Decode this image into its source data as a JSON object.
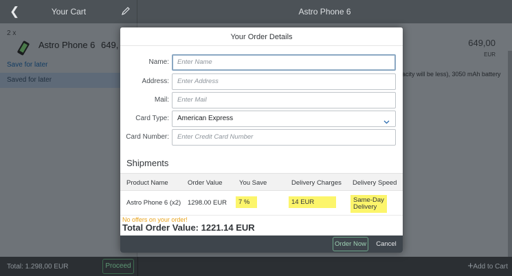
{
  "header": {
    "cart_title": "Your Cart",
    "detail_title": "Astro Phone 6"
  },
  "cart": {
    "quantity": "2 x",
    "item_name": "Astro Phone 6",
    "item_price": "649,",
    "save_for_later": "Save for later",
    "saved_for_later_header": "Saved for later"
  },
  "detail": {
    "price": "649,00",
    "currency": "EUR",
    "description": "acity will be less), 3050 mAh battery"
  },
  "footer": {
    "total": "Total: 1.298,00 EUR",
    "proceed": "Proceed",
    "add_to_cart": "Add to Cart"
  },
  "dialog": {
    "title": "Your Order Details",
    "fields": {
      "name_label": "Name:",
      "name_placeholder": "Enter Name",
      "address_label": "Address:",
      "address_placeholder": "Enter Address",
      "mail_label": "Mail:",
      "mail_placeholder": "Enter Mail",
      "card_type_label": "Card Type:",
      "card_type_value": "American Express",
      "card_number_label": "Card Number:",
      "card_number_placeholder": "Enter Credit Card Number"
    },
    "shipments": {
      "title": "Shipments",
      "columns": [
        "Product Name",
        "Order Value",
        "You Save",
        "Delivery Charges",
        "Delivery Speed"
      ],
      "rows": [
        {
          "product": "Astro Phone 6 (x2)",
          "order_value": "1298.00 EUR",
          "you_save": "7 %",
          "delivery_charges": "14 EUR",
          "delivery_speed": "Same-Day Delivery"
        }
      ]
    },
    "no_offers": "No offers on your order!",
    "total_order_value": "Total Order Value: 1221.14 EUR",
    "order_now": "Order Now",
    "cancel": "Cancel"
  },
  "colors": {
    "highlight": "#fcf56b",
    "warning": "#e8a21a",
    "accept": "#6fa68a"
  }
}
